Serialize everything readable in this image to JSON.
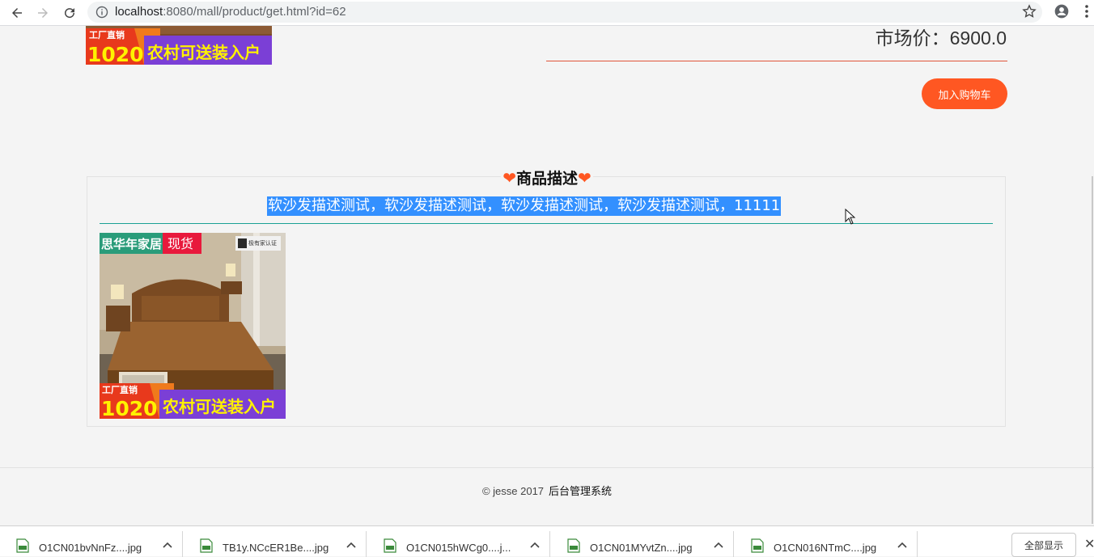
{
  "browser": {
    "url_host": "localhost",
    "url_path": ":8080/mall/product/get.html?id=62",
    "icons": {
      "back": "back-arrow-icon",
      "forward": "forward-arrow-icon",
      "reload": "reload-icon",
      "info": "info-icon",
      "star": "star-icon",
      "profile": "profile-icon",
      "menu": "menu-icon"
    }
  },
  "product": {
    "banner_tag": "工厂直销",
    "banner_number": "1020",
    "banner_slogan": "农村可送装入户",
    "price_label": "市场价：6900.0",
    "add_to_cart_label": "加入购物车",
    "accent_color": "#ff5722"
  },
  "description": {
    "heart": "❤",
    "title": "商品描述",
    "text": "软沙发描述测试，软沙发描述测试，软沙发描述测试，软沙发描述测试，11111",
    "image_brand": "思华年家居",
    "image_badge": "现货",
    "image_cert": "极有家认证",
    "image_tag": "工厂直销",
    "image_number": "1020",
    "image_slogan": "农村可送装入户"
  },
  "footer": {
    "copyright": "© jesse 2017",
    "admin_link": "后台管理系统"
  },
  "downloads": {
    "items": [
      {
        "name": "O1CN01bvNnFz....jpg"
      },
      {
        "name": "TB1y.NCcER1Be....jpg"
      },
      {
        "name": "O1CN015hWCg0....j..."
      },
      {
        "name": "O1CN01MYvtZn....jpg"
      },
      {
        "name": "O1CN016NTmC....jpg"
      }
    ],
    "show_all_label": "全部显示",
    "close_label": "✕"
  }
}
